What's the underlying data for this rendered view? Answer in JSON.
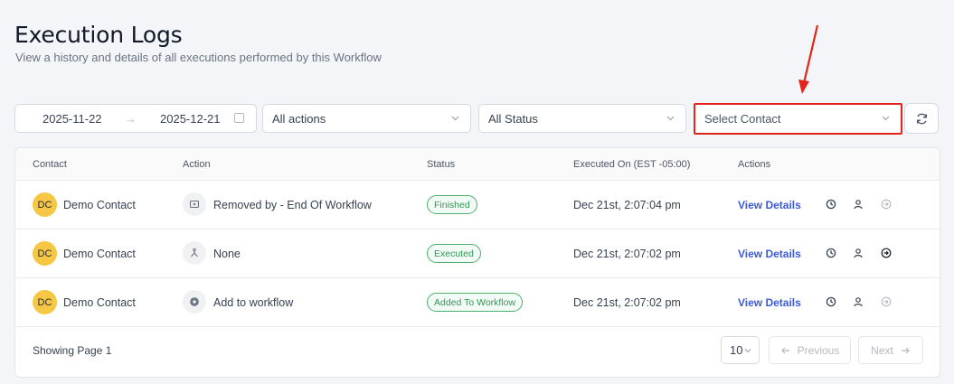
{
  "header": {
    "title": "Execution Logs",
    "subtitle": "View a history and details of all executions performed by this Workflow"
  },
  "filters": {
    "date_start": "2025-11-22",
    "date_arrow": "→",
    "date_end": "2025-12-21",
    "actions": "All actions",
    "status": "All Status",
    "contact_placeholder": "Select Contact"
  },
  "table": {
    "columns": [
      "Contact",
      "Action",
      "Status",
      "Executed On (EST -05:00)",
      "Actions"
    ],
    "rows": [
      {
        "initials": "DC",
        "contact": "Demo Contact",
        "action_icon": "remove-icon",
        "action": "Removed by - End Of Workflow",
        "status": "Finished",
        "executed_on": "Dec 21st, 2:07:04 pm",
        "link": "View Details"
      },
      {
        "initials": "DC",
        "contact": "Demo Contact",
        "action_icon": "branch-icon",
        "action": "None",
        "status": "Executed",
        "executed_on": "Dec 21st, 2:07:02 pm",
        "link": "View Details"
      },
      {
        "initials": "DC",
        "contact": "Demo Contact",
        "action_icon": "plus-circle-icon",
        "action": "Add to workflow",
        "status": "Added To Workflow",
        "executed_on": "Dec 21st, 2:07:02 pm",
        "link": "View Details"
      }
    ]
  },
  "footer": {
    "showing": "Showing Page 1",
    "page_size": "10",
    "previous": "Previous",
    "next": "Next"
  },
  "colors": {
    "accent": "#3b5bdb",
    "highlight": "#e1251b",
    "badge_green": "#2f9a55",
    "avatar": "#f6c744"
  }
}
